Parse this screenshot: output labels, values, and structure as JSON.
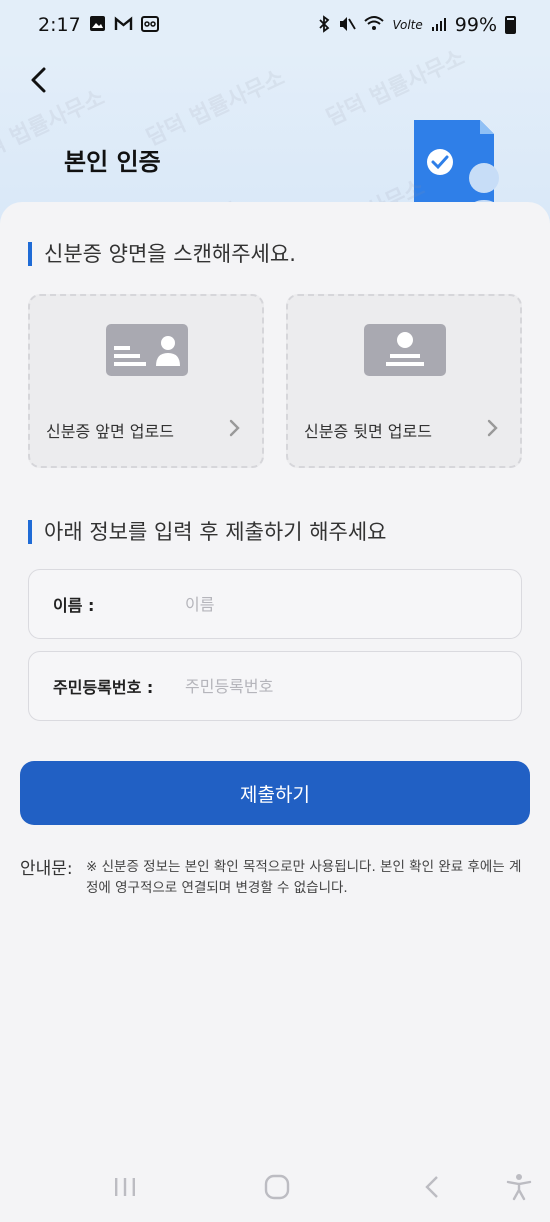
{
  "status_bar": {
    "time": "2:17",
    "battery": "99%",
    "network": "Volte"
  },
  "header": {
    "title": "본인 인증"
  },
  "scan_section": {
    "title": "신분증 양면을 스캔해주세요.",
    "front_label": "신분증 앞면 업로드",
    "back_label": "신분증 뒷면 업로드"
  },
  "form_section": {
    "title": "아래 정보를 입력 후 제출하기 해주세요",
    "name_label": "이름 :",
    "name_placeholder": "이름",
    "name_value": "",
    "rrn_label": "주민등록번호 :",
    "rrn_placeholder": "주민등록번호",
    "rrn_value": ""
  },
  "submit_label": "제출하기",
  "notice": {
    "label": "안내문:",
    "text": "※ 신분증 정보는 본인 확인 목적으로만 사용됩니다. 본인 확인 완료 후에는 계정에 영구적으로 연결되며 변경할 수 없습니다."
  },
  "watermark_text": "담덕 법률사무소",
  "colors": {
    "accent": "#2160c4",
    "header_bg": "#e3eef9"
  }
}
